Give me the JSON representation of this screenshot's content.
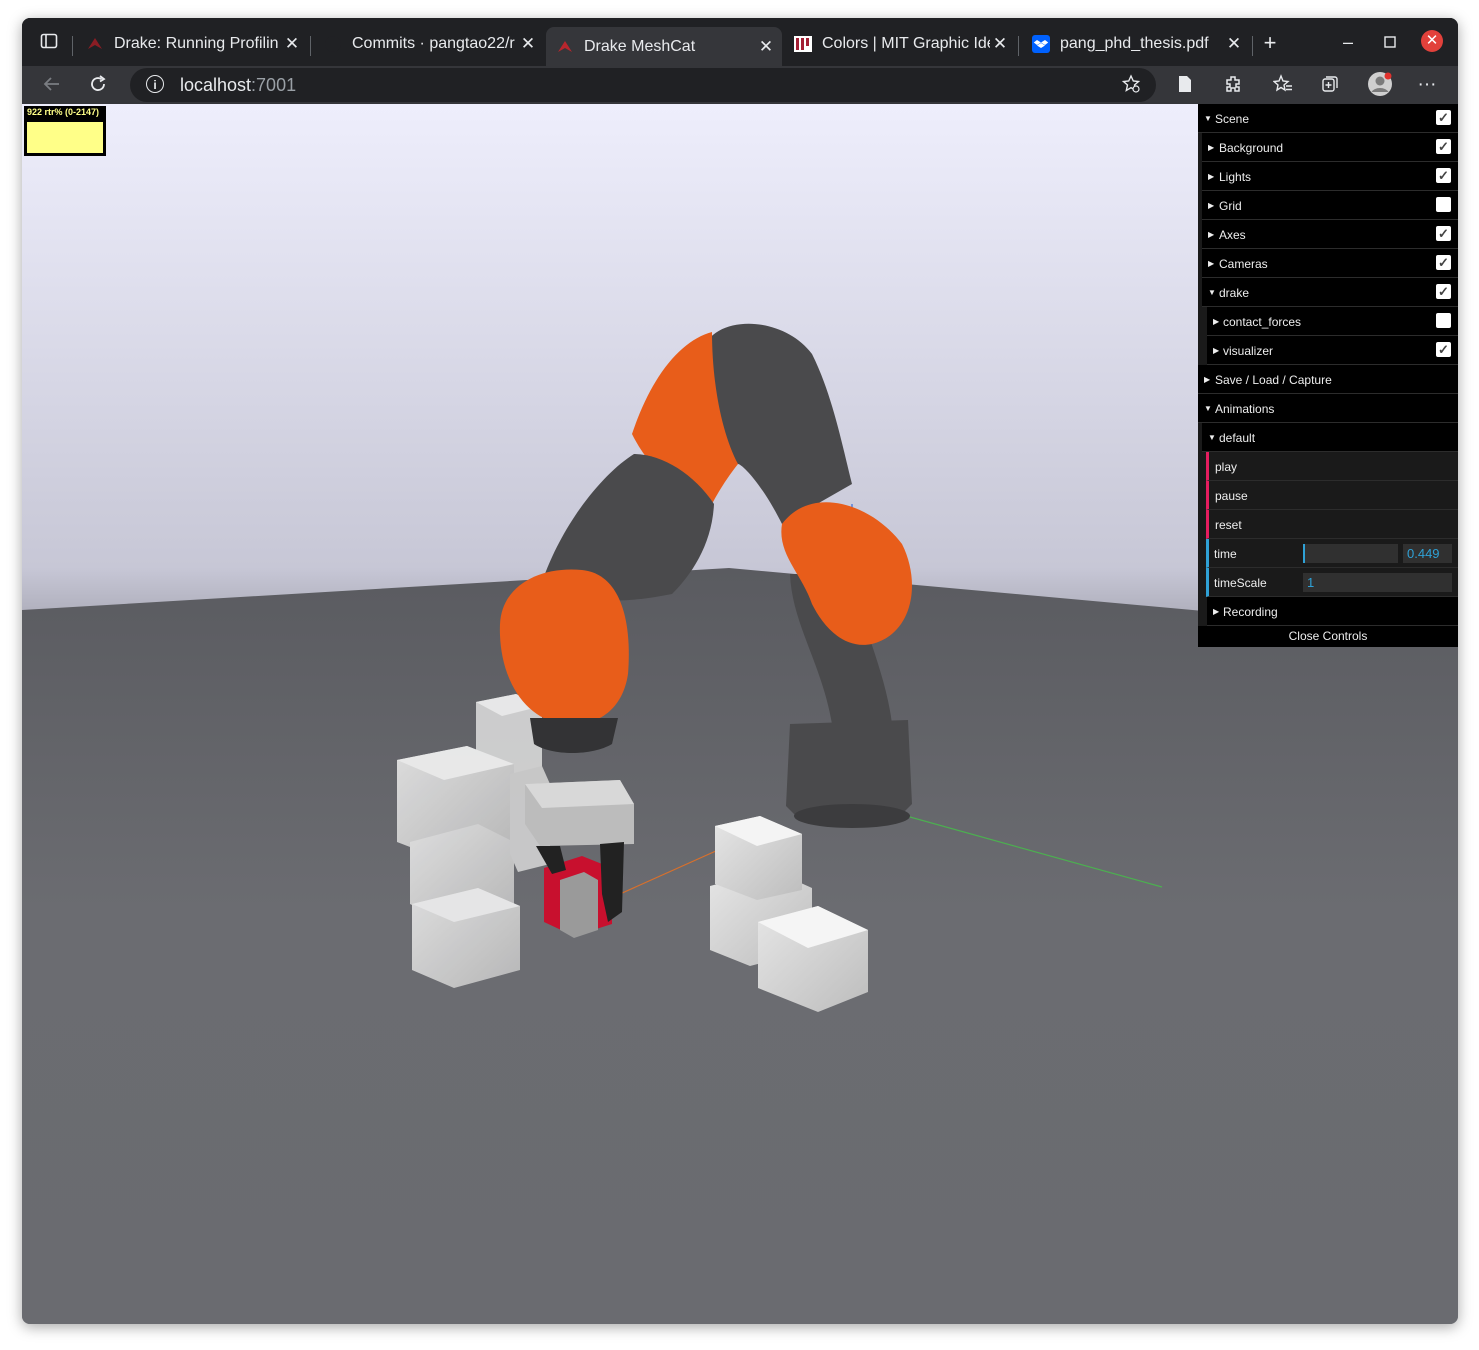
{
  "tabs": [
    {
      "title": "Drake: Running Profilin",
      "active": false
    },
    {
      "title": "Commits · pangtao22/r",
      "active": false
    },
    {
      "title": "Drake MeshCat",
      "active": true
    },
    {
      "title": "Colors | MIT Graphic Ide",
      "active": false
    },
    {
      "title": "pang_phd_thesis.pdf",
      "active": false
    }
  ],
  "address": {
    "host": "localhost",
    "port": ":7001"
  },
  "stats": {
    "label": "922 rtr% (0-2147)"
  },
  "gui": {
    "scene": "Scene",
    "background": "Background",
    "lights": "Lights",
    "grid": "Grid",
    "axes": "Axes",
    "cameras": "Cameras",
    "drake": "drake",
    "contact_forces": "contact_forces",
    "visualizer": "visualizer",
    "save_load": "Save / Load / Capture",
    "animations": "Animations",
    "default": "default",
    "play": "play",
    "pause": "pause",
    "reset": "reset",
    "time": "time",
    "time_value": "0.449",
    "time_fraction": 0.02,
    "timescale": "timeScale",
    "timescale_value": "1",
    "recording": "Recording",
    "close_controls": "Close Controls"
  },
  "checkboxes": {
    "scene": true,
    "background": true,
    "lights": true,
    "grid": false,
    "axes": true,
    "cameras": true,
    "drake": true,
    "contact_forces": false,
    "visualizer": true
  },
  "colors": {
    "robot_orange": "#e85d1a",
    "robot_gray": "#4a4a4c",
    "gui_function": "#e61d5f",
    "gui_number": "#2fa1d6"
  }
}
